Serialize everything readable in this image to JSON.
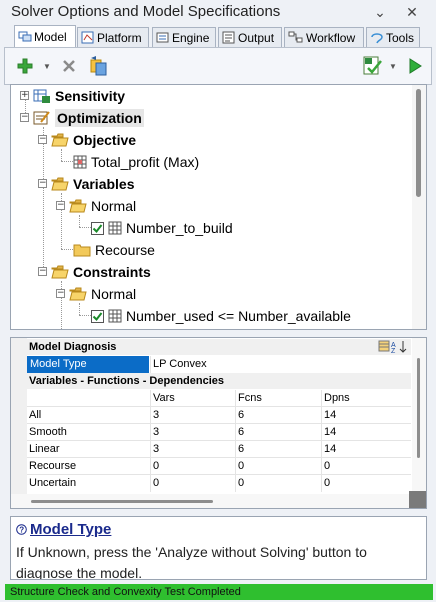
{
  "window": {
    "title": "Solver Options and Model Specifications"
  },
  "tabs": [
    {
      "label": "Model",
      "icon": "model-icon"
    },
    {
      "label": "Platform",
      "icon": "platform-icon"
    },
    {
      "label": "Engine",
      "icon": "engine-icon"
    },
    {
      "label": "Output",
      "icon": "output-icon"
    },
    {
      "label": "Workflow",
      "icon": "workflow-icon"
    },
    {
      "label": "Tools",
      "icon": "tools-icon"
    }
  ],
  "active_tab": "Model",
  "tree": {
    "sensitivity": "Sensitivity",
    "optimization": "Optimization",
    "objective": "Objective",
    "objective_item": "Total_profit (Max)",
    "variables": "Variables",
    "var_normal": "Normal",
    "var_item": "Number_to_build",
    "recourse": "Recourse",
    "constraints": "Constraints",
    "con_normal": "Normal",
    "con_item": "Number_used <= Number_available"
  },
  "diagnosis": {
    "category": "Model Diagnosis",
    "model_type_label": "Model Type",
    "model_type_value": "LP Convex",
    "vfd_category": "Variables - Functions - Dependencies",
    "columns": [
      "",
      "Vars",
      "Fcns",
      "Dpns"
    ],
    "rows": [
      [
        "All",
        "3",
        "6",
        "14"
      ],
      [
        "Smooth",
        "3",
        "6",
        "14"
      ],
      [
        "Linear",
        "3",
        "6",
        "14"
      ],
      [
        "Recourse",
        "0",
        "0",
        "0"
      ],
      [
        "Uncertain",
        "0",
        "0",
        "0"
      ]
    ]
  },
  "help": {
    "title": "Model Type",
    "text": "If Unknown, press the 'Analyze without Solving' button to diagnose the model."
  },
  "status": {
    "text": "Structure Check and Convexity Test Completed",
    "color": "#2fbf2f"
  },
  "colors": {
    "selection": "#0b6cc7",
    "help_title": "#1a2a8c"
  }
}
